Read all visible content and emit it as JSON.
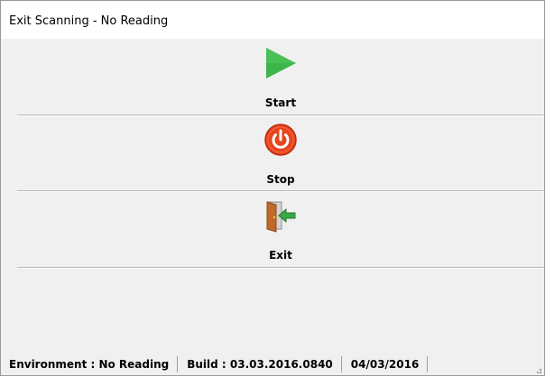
{
  "window": {
    "title": "Exit Scanning - No Reading"
  },
  "actions": {
    "start": {
      "label": "Start",
      "icon": "play-icon",
      "color": "#3cb54a"
    },
    "stop": {
      "label": "Stop",
      "icon": "power-icon",
      "color": "#e8431c"
    },
    "exit": {
      "label": "Exit",
      "icon": "exit-door-icon",
      "color": "#3aa845"
    }
  },
  "statusbar": {
    "environment": "Environment : No Reading",
    "build": "Build : 03.03.2016.0840",
    "date": "04/03/2016"
  }
}
